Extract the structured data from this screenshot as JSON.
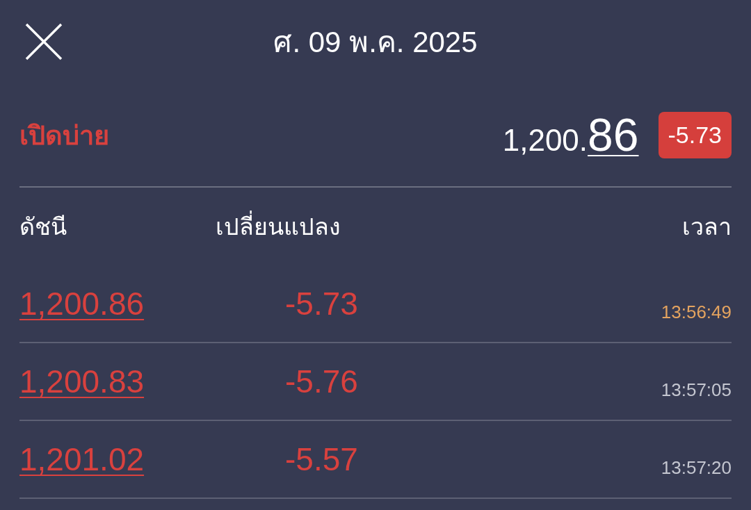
{
  "header": {
    "title": "ศ. 09 พ.ค. 2025"
  },
  "session": {
    "label": "เปิดบ่าย",
    "price_main": "1,200.",
    "price_decimal": "86",
    "change": "-5.73"
  },
  "table": {
    "columns": [
      "ดัชนี",
      "เปลี่ยนแปลง",
      "เวลา"
    ],
    "rows": [
      {
        "index": "1,200.86",
        "change": "-5.73",
        "time": "13:56:49",
        "highlighted": true
      },
      {
        "index": "1,200.83",
        "change": "-5.76",
        "time": "13:57:05",
        "highlighted": false
      },
      {
        "index": "1,201.02",
        "change": "-5.57",
        "time": "13:57:20",
        "highlighted": false
      }
    ]
  }
}
